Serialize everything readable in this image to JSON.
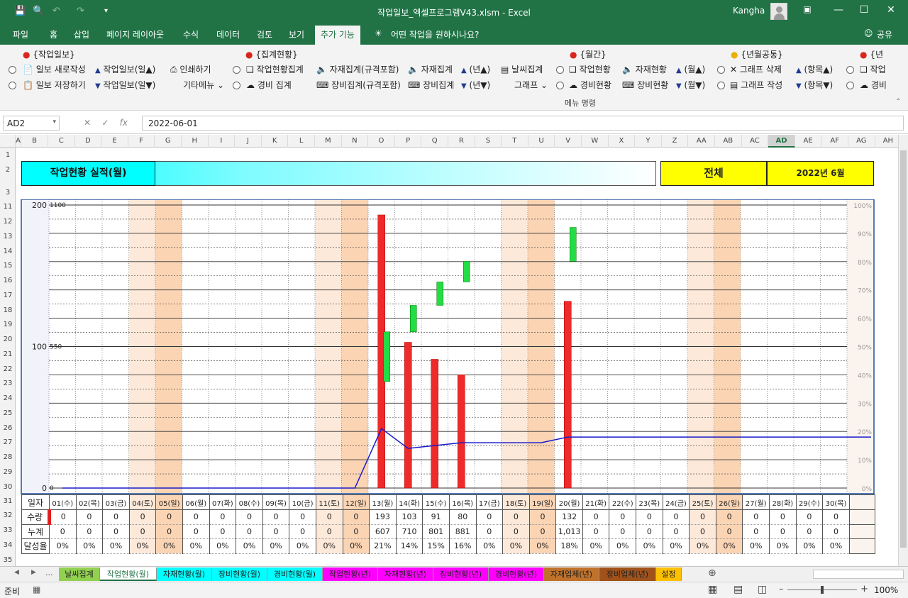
{
  "window": {
    "title": "작업일보_엑셀프로그램V43.xlsm  -  Excel",
    "user": "Kangha"
  },
  "ribbon_tabs": [
    "파일",
    "홈",
    "삽입",
    "페이지 레이아웃",
    "수식",
    "데이터",
    "검토",
    "보기",
    "추가 기능"
  ],
  "tell_me": "어떤 작업을 원하시나요?",
  "share": "공유",
  "ribbon": {
    "groups": [
      "{작업일보}",
      "{집계현황}",
      "{월간}",
      "{년월공통}",
      "{년"
    ],
    "r1": [
      "일보 새로작성",
      "작업일보(일▲)",
      "인쇄하기",
      "작업현황집계",
      "자재집계(규격포함)",
      "자재집계",
      "(년▲)",
      "날씨집계",
      "작업현황",
      "자재현황",
      "(월▲)",
      "그래프 삭제",
      "(항목▲)",
      "작업"
    ],
    "r2": [
      "일보 저장하기",
      "작업일보(일▼)",
      "기타메뉴",
      "경비 집계",
      "장비집계(규격포함)",
      "장비집계",
      "(년▼)",
      "그래프",
      "경비현황",
      "장비현황",
      "(월▼)",
      "그래프 작성",
      "(항목▼)",
      "경비"
    ],
    "label": "메뉴 명령"
  },
  "formula": {
    "cell": "AD2",
    "value": "2022-06-01"
  },
  "columns": [
    "A",
    "B",
    "C",
    "D",
    "E",
    "F",
    "G",
    "H",
    "I",
    "J",
    "K",
    "L",
    "M",
    "N",
    "O",
    "P",
    "Q",
    "R",
    "S",
    "T",
    "U",
    "V",
    "W",
    "X",
    "Y",
    "Z",
    "AA",
    "AB",
    "AC",
    "AD",
    "AE",
    "AF",
    "AG",
    "AH"
  ],
  "rows": [
    "1",
    "2",
    "3",
    "11",
    "12",
    "13",
    "14",
    "15",
    "16",
    "17",
    "18",
    "19",
    "20",
    "21",
    "22",
    "23",
    "24",
    "25",
    "26",
    "27",
    "28",
    "29",
    "30",
    "31",
    "32",
    "33",
    "34",
    "35"
  ],
  "banner": {
    "title": "작업현황 실적(월)",
    "scope": "전체",
    "month": "2022년 6월"
  },
  "axis": {
    "left": [
      "200",
      "100",
      "0"
    ],
    "inner": [
      "1100",
      "550",
      "0"
    ],
    "right": [
      "100%",
      "90%",
      "80%",
      "70%",
      "60%",
      "50%",
      "40%",
      "30%",
      "20%",
      "10%",
      "0%"
    ]
  },
  "table": {
    "row_labels": [
      "일자",
      "수량",
      "누계",
      "달성율"
    ],
    "dates": [
      "01(수)",
      "02(목)",
      "03(금)",
      "04(토)",
      "05(일)",
      "06(월)",
      "07(화)",
      "08(수)",
      "09(목)",
      "10(금)",
      "11(토)",
      "12(일)",
      "13(월)",
      "14(화)",
      "15(수)",
      "16(목)",
      "17(금)",
      "18(토)",
      "19(일)",
      "20(월)",
      "21(화)",
      "22(수)",
      "23(목)",
      "24(금)",
      "25(토)",
      "26(일)",
      "27(월)",
      "28(화)",
      "29(수)",
      "30(목)"
    ],
    "qty": [
      "0",
      "0",
      "0",
      "0",
      "0",
      "0",
      "0",
      "0",
      "0",
      "0",
      "0",
      "0",
      "193",
      "103",
      "91",
      "80",
      "0",
      "0",
      "0",
      "132",
      "0",
      "0",
      "0",
      "0",
      "0",
      "0",
      "0",
      "0",
      "0",
      "0"
    ],
    "cum": [
      "0",
      "0",
      "0",
      "0",
      "0",
      "0",
      "0",
      "0",
      "0",
      "0",
      "0",
      "0",
      "607",
      "710",
      "801",
      "881",
      "0",
      "0",
      "0",
      "1,013",
      "0",
      "0",
      "0",
      "0",
      "0",
      "0",
      "0",
      "0",
      "0",
      "0"
    ],
    "rate": [
      "0%",
      "0%",
      "0%",
      "0%",
      "0%",
      "0%",
      "0%",
      "0%",
      "0%",
      "0%",
      "0%",
      "0%",
      "21%",
      "14%",
      "15%",
      "16%",
      "0%",
      "0%",
      "0%",
      "18%",
      "0%",
      "0%",
      "0%",
      "0%",
      "0%",
      "0%",
      "0%",
      "0%",
      "0%",
      "0%"
    ]
  },
  "chart_data": {
    "type": "bar",
    "categories": [
      "01(수)",
      "02(목)",
      "03(금)",
      "04(토)",
      "05(일)",
      "06(월)",
      "07(화)",
      "08(수)",
      "09(목)",
      "10(금)",
      "11(토)",
      "12(일)",
      "13(월)",
      "14(화)",
      "15(수)",
      "16(목)",
      "17(금)",
      "18(토)",
      "19(일)",
      "20(월)",
      "21(화)",
      "22(수)",
      "23(목)",
      "24(금)",
      "25(토)",
      "26(일)",
      "27(월)",
      "28(화)",
      "29(수)",
      "30(목)"
    ],
    "series": [
      {
        "values": [
          0,
          0,
          0,
          0,
          0,
          0,
          0,
          0,
          0,
          0,
          0,
          0,
          193,
          103,
          91,
          80,
          0,
          0,
          0,
          132,
          0,
          0,
          0,
          0,
          0,
          0,
          0,
          0,
          0,
          0
        ]
      },
      {
        "values": [
          0,
          0,
          0,
          0,
          0,
          0,
          0,
          0,
          0,
          0,
          0,
          0,
          607,
          710,
          801,
          881,
          0,
          0,
          0,
          1013,
          0,
          0,
          0,
          0,
          0,
          0,
          0,
          0,
          0,
          0
        ]
      },
      {
        "values": [
          0,
          0,
          0,
          0,
          0,
          0,
          0,
          0,
          0,
          0,
          0,
          0,
          21,
          14,
          15,
          16,
          16,
          16,
          16,
          18,
          18,
          18,
          18,
          18,
          18,
          18,
          18,
          18,
          18,
          18
        ]
      }
    ],
    "ylim": [
      0,
      200
    ],
    "cum_ylim": [
      0,
      1100
    ],
    "rate_ylim": [
      0,
      100
    ],
    "weekend_days": [
      "04(토)",
      "05(일)",
      "11(토)",
      "12(일)",
      "18(토)",
      "19(일)",
      "25(토)",
      "26(일)"
    ]
  },
  "sheet_tabs": [
    {
      "label": "날씨집계",
      "color": "#92d050"
    },
    {
      "label": "작업현황(월)",
      "color": "#ffffff"
    },
    {
      "label": "자재현황(월)",
      "color": "#00ffff"
    },
    {
      "label": "장비현황(월)",
      "color": "#00ffff"
    },
    {
      "label": "경비현황(월)",
      "color": "#00ffff"
    },
    {
      "label": "작업현황(년)",
      "color": "#ff00ff"
    },
    {
      "label": "자재현황(년)",
      "color": "#ff00ff"
    },
    {
      "label": "장비현황(년)",
      "color": "#ff00ff"
    },
    {
      "label": "경비현황(년)",
      "color": "#ff00ff"
    },
    {
      "label": "자재업체(년)",
      "color": "#c0722a"
    },
    {
      "label": "장비업체(년)",
      "color": "#a0521a"
    },
    {
      "label": "설정",
      "color": "#ffc000"
    }
  ],
  "status": {
    "ready": "준비",
    "zoom": "100%"
  },
  "colors": {
    "excel_green": "#217346",
    "bar": "#ee2b2b",
    "cum": "#22dd44",
    "line": "#1a1acc",
    "weekend_sat": "#fde9d9",
    "weekend_sun": "#fbd4b4",
    "banner_cyan": "#00ffff",
    "banner_yellow": "#ffff00"
  }
}
